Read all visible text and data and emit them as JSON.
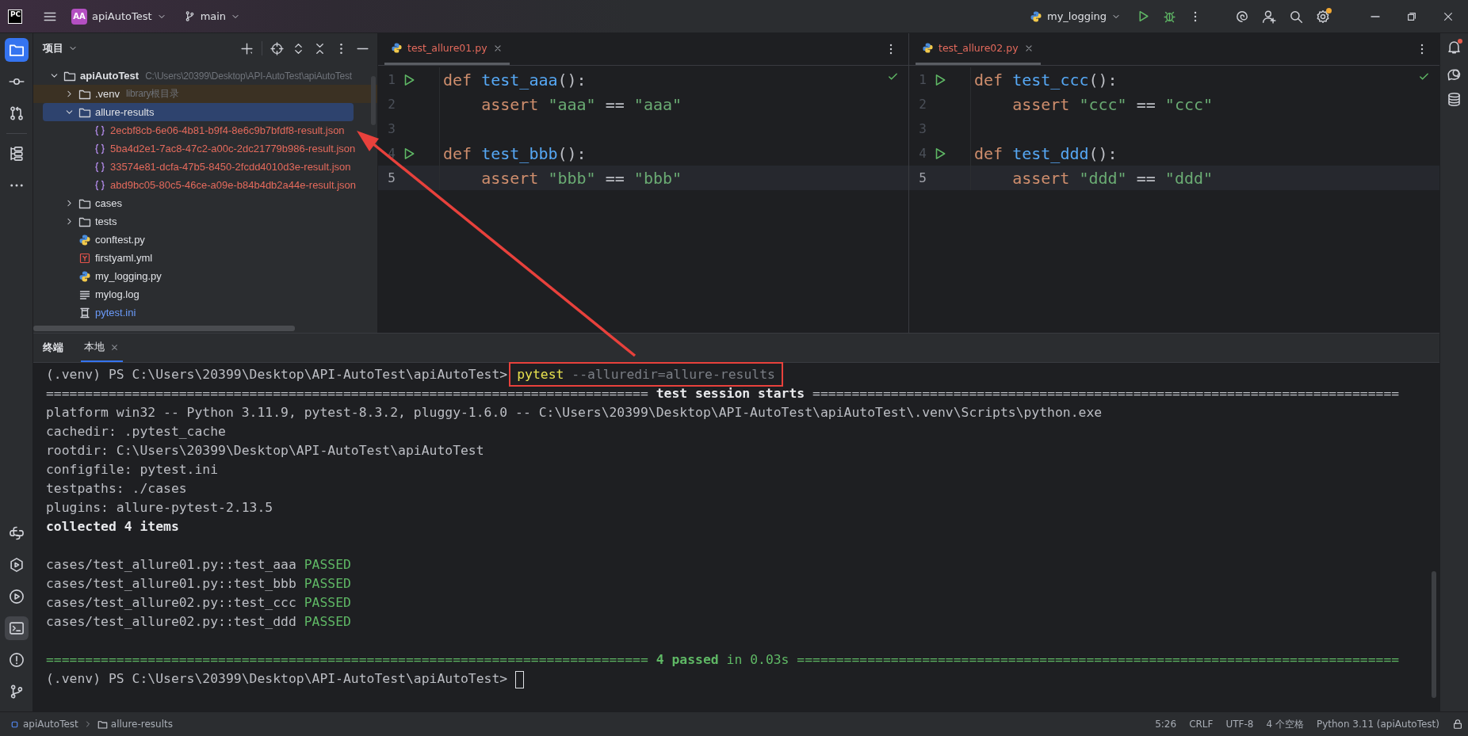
{
  "title_bar": {
    "logo": "PC",
    "project_badge": "AA",
    "project": "apiAutoTest",
    "branch": "main",
    "run_config": "my_logging",
    "settings_badge": true
  },
  "left_toolbar": {
    "top": [
      {
        "kind": "project",
        "selected": true
      },
      {
        "kind": "commit",
        "selected": false
      },
      {
        "kind": "pull-requests",
        "selected": false
      },
      {
        "kind": "structure",
        "selected": false
      },
      {
        "kind": "more",
        "selected": false
      }
    ],
    "bottom": [
      {
        "kind": "python-console",
        "selected": false
      },
      {
        "kind": "services",
        "selected": false
      },
      {
        "kind": "run",
        "selected": false
      },
      {
        "kind": "terminal",
        "selected": true
      },
      {
        "kind": "problems",
        "selected": false
      },
      {
        "kind": "git",
        "selected": false
      }
    ]
  },
  "right_toolbar": [
    {
      "kind": "notifications",
      "badge": true
    },
    {
      "kind": "ai-chat",
      "badge": false
    },
    {
      "kind": "database",
      "badge": false
    }
  ],
  "project_panel": {
    "title": "项目",
    "tree": [
      {
        "name": "apiAutoTest",
        "kind": "folder",
        "unversioned": false,
        "modified": false,
        "path": "C:\\Users\\20399\\Desktop\\API-AutoTest\\apiAutoTest",
        "expanded": true,
        "selected": false,
        "excluded": false,
        "children": [
          {
            "name": ".venv",
            "kind": "folder",
            "unversioned": false,
            "modified": false,
            "hint": "library根目录",
            "expanded": false,
            "selected": false,
            "excluded": true
          },
          {
            "name": "allure-results",
            "kind": "folder",
            "unversioned": false,
            "modified": false,
            "expanded": true,
            "selected": true,
            "excluded": false,
            "children": [
              {
                "name": "2ecbf8cb-6e06-4b81-b9f4-8e6c9b7bfdf8-result.json",
                "kind": "json",
                "unversioned": true,
                "modified": false,
                "selected": false,
                "excluded": false
              },
              {
                "name": "5ba4d2e1-7ac8-47c2-a00c-2dc21779b986-result.json",
                "kind": "json",
                "unversioned": true,
                "modified": false,
                "selected": false,
                "excluded": false
              },
              {
                "name": "33574e81-dcfa-47b5-8450-2fcdd4010d3e-result.json",
                "kind": "json",
                "unversioned": true,
                "modified": false,
                "selected": false,
                "excluded": false
              },
              {
                "name": "abd9bc05-80c5-46ce-a09e-b84b4db2a44e-result.json",
                "kind": "json",
                "unversioned": true,
                "modified": false,
                "selected": false,
                "excluded": false
              }
            ]
          },
          {
            "name": "cases",
            "kind": "folder",
            "unversioned": false,
            "modified": false,
            "expanded": false,
            "selected": false,
            "excluded": false
          },
          {
            "name": "tests",
            "kind": "folder",
            "unversioned": false,
            "modified": false,
            "expanded": false,
            "selected": false,
            "excluded": false
          },
          {
            "name": "conftest.py",
            "kind": "python",
            "unversioned": false,
            "modified": false,
            "selected": false,
            "excluded": false
          },
          {
            "name": "firstyaml.yml",
            "kind": "yaml",
            "unversioned": false,
            "modified": false,
            "selected": false,
            "excluded": false
          },
          {
            "name": "my_logging.py",
            "kind": "python",
            "unversioned": false,
            "modified": false,
            "selected": false,
            "excluded": false
          },
          {
            "name": "mylog.log",
            "kind": "log",
            "unversioned": false,
            "modified": false,
            "selected": false,
            "excluded": false
          },
          {
            "name": "pytest.ini",
            "kind": "ini",
            "unversioned": false,
            "modified": true,
            "selected": false,
            "excluded": false
          }
        ]
      }
    ]
  },
  "editors": [
    {
      "tab": {
        "name": "test_allure01.py",
        "unversioned": true,
        "selected": true
      },
      "no_problems": true,
      "lines": [
        {
          "number": "1",
          "run": true,
          "current": false,
          "tokens": [
            {
              "kind": "keyword",
              "text": "def "
            },
            {
              "kind": "function",
              "text": "test_aaa"
            },
            {
              "kind": "plain",
              "text": "():"
            }
          ]
        },
        {
          "number": "2",
          "run": false,
          "current": false,
          "tokens": [
            {
              "kind": "keyword",
              "text": "    assert "
            },
            {
              "kind": "string",
              "text": "\"aaa\""
            },
            {
              "kind": "plain",
              "text": " == "
            },
            {
              "kind": "string",
              "text": "\"aaa\""
            }
          ]
        },
        {
          "number": "3",
          "run": false,
          "current": false
        },
        {
          "number": "4",
          "run": true,
          "current": false,
          "tokens": [
            {
              "kind": "keyword",
              "text": "def "
            },
            {
              "kind": "function",
              "text": "test_bbb"
            },
            {
              "kind": "plain",
              "text": "():"
            }
          ]
        },
        {
          "number": "5",
          "run": false,
          "current": true,
          "tokens": [
            {
              "kind": "keyword",
              "text": "    assert "
            },
            {
              "kind": "string",
              "text": "\"bbb\""
            },
            {
              "kind": "plain",
              "text": " == "
            },
            {
              "kind": "string",
              "text": "\"bbb\""
            }
          ]
        }
      ]
    },
    {
      "tab": {
        "name": "test_allure02.py",
        "unversioned": true,
        "selected": true
      },
      "no_problems": true,
      "lines": [
        {
          "number": "1",
          "run": true,
          "current": false,
          "tokens": [
            {
              "kind": "keyword",
              "text": "def "
            },
            {
              "kind": "function",
              "text": "test_ccc"
            },
            {
              "kind": "plain",
              "text": "():"
            }
          ]
        },
        {
          "number": "2",
          "run": false,
          "current": false,
          "tokens": [
            {
              "kind": "keyword",
              "text": "    assert "
            },
            {
              "kind": "string",
              "text": "\"ccc\""
            },
            {
              "kind": "plain",
              "text": " == "
            },
            {
              "kind": "string",
              "text": "\"ccc\""
            }
          ]
        },
        {
          "number": "3",
          "run": false,
          "current": false
        },
        {
          "number": "4",
          "run": true,
          "current": false,
          "tokens": [
            {
              "kind": "keyword",
              "text": "def "
            },
            {
              "kind": "function",
              "text": "test_ddd"
            },
            {
              "kind": "plain",
              "text": "():"
            }
          ]
        },
        {
          "number": "5",
          "run": false,
          "current": true,
          "tokens": [
            {
              "kind": "keyword",
              "text": "    assert "
            },
            {
              "kind": "string",
              "text": "\"ddd\""
            },
            {
              "kind": "plain",
              "text": " == "
            },
            {
              "kind": "string",
              "text": "\"ddd\""
            }
          ]
        }
      ]
    }
  ],
  "terminal": {
    "title": "终端",
    "tabs": [
      {
        "label": "本地",
        "selected": true
      }
    ],
    "lines": [
      {
        "kind": "prompt",
        "prompt": "(.venv) PS C:\\Users\\20399\\Desktop\\API-AutoTest\\apiAutoTest>",
        "annotated": true,
        "cursor": false,
        "command": [
          {
            "kind": "command",
            "text": "pytest"
          },
          {
            "kind": "argument",
            "text": " --alluredir=allure-results"
          }
        ]
      },
      {
        "kind": "output",
        "segments": [
          {
            "kind": "plain",
            "text": "============================================================================= "
          },
          {
            "kind": "bold",
            "text": "test session starts"
          },
          {
            "kind": "plain",
            "text": " ==========================================================================="
          }
        ]
      },
      {
        "kind": "output",
        "segments": [
          {
            "kind": "plain",
            "text": "platform win32 -- Python 3.11.9, pytest-8.3.2, pluggy-1.6.0 -- C:\\Users\\20399\\Desktop\\API-AutoTest\\apiAutoTest\\.venv\\Scripts\\python.exe"
          }
        ]
      },
      {
        "kind": "output",
        "segments": [
          {
            "kind": "plain",
            "text": "cachedir: .pytest_cache"
          }
        ]
      },
      {
        "kind": "output",
        "segments": [
          {
            "kind": "plain",
            "text": "rootdir: C:\\Users\\20399\\Desktop\\API-AutoTest\\apiAutoTest"
          }
        ]
      },
      {
        "kind": "output",
        "segments": [
          {
            "kind": "plain",
            "text": "configfile: pytest.ini"
          }
        ]
      },
      {
        "kind": "output",
        "segments": [
          {
            "kind": "plain",
            "text": "testpaths: ./cases"
          }
        ]
      },
      {
        "kind": "output",
        "segments": [
          {
            "kind": "plain",
            "text": "plugins: allure-pytest-2.13.5"
          }
        ]
      },
      {
        "kind": "output",
        "segments": [
          {
            "kind": "bold",
            "text": "collected 4 items"
          }
        ]
      },
      {
        "kind": "blank"
      },
      {
        "kind": "output",
        "segments": [
          {
            "kind": "plain",
            "text": "cases/test_allure01.py::test_aaa "
          },
          {
            "kind": "pass",
            "text": "PASSED"
          }
        ]
      },
      {
        "kind": "output",
        "segments": [
          {
            "kind": "plain",
            "text": "cases/test_allure01.py::test_bbb "
          },
          {
            "kind": "pass",
            "text": "PASSED"
          }
        ]
      },
      {
        "kind": "output",
        "segments": [
          {
            "kind": "plain",
            "text": "cases/test_allure02.py::test_ccc "
          },
          {
            "kind": "pass",
            "text": "PASSED"
          }
        ]
      },
      {
        "kind": "output",
        "segments": [
          {
            "kind": "plain",
            "text": "cases/test_allure02.py::test_ddd "
          },
          {
            "kind": "pass",
            "text": "PASSED"
          }
        ]
      },
      {
        "kind": "blank"
      },
      {
        "kind": "output",
        "segments": [
          {
            "kind": "pass",
            "text": "============================================================================= "
          },
          {
            "kind": "pass-bold",
            "text": "4 passed"
          },
          {
            "kind": "pass",
            "text": " in 0.03s ============================================================================="
          }
        ]
      },
      {
        "kind": "prompt",
        "prompt": "(.venv) PS C:\\Users\\20399\\Desktop\\API-AutoTest\\apiAutoTest>",
        "annotated": false,
        "cursor": true
      }
    ]
  },
  "status_bar": {
    "breadcrumbs": [
      {
        "kind": "module",
        "label": "apiAutoTest"
      },
      {
        "kind": "folder",
        "label": "allure-results"
      }
    ],
    "items": [
      "5:26",
      "CRLF",
      "UTF-8",
      "4 个空格",
      "Python 3.11 (apiAutoTest)"
    ]
  }
}
